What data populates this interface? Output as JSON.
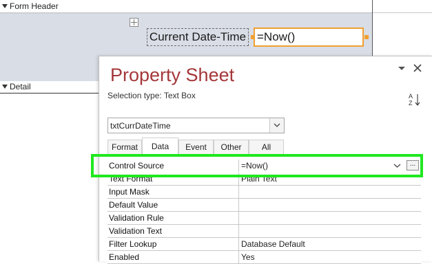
{
  "form": {
    "header_label": "Form Header",
    "detail_label": "Detail",
    "label_control_text": "Current Date-Time",
    "textbox_control_text": "=Now()"
  },
  "property_sheet": {
    "title": "Property Sheet",
    "selection_type": "Selection type:  Text Box",
    "object_combo_value": "txtCurrDateTime",
    "sort_icon_text": "A\nZ",
    "tabs": [
      {
        "label": "Format"
      },
      {
        "label": "Data"
      },
      {
        "label": "Event"
      },
      {
        "label": "Other"
      },
      {
        "label": "All"
      }
    ],
    "active_tab": "Data",
    "control_source": {
      "name": "Control Source",
      "value": "=Now()",
      "build_label": "..."
    },
    "rows": [
      {
        "name": "Text Format",
        "value": "Plain Text"
      },
      {
        "name": "Input Mask",
        "value": ""
      },
      {
        "name": "Default Value",
        "value": ""
      },
      {
        "name": "Validation Rule",
        "value": ""
      },
      {
        "name": "Validation Text",
        "value": ""
      },
      {
        "name": "Filter Lookup",
        "value": "Database Default"
      },
      {
        "name": "Enabled",
        "value": "Yes"
      }
    ]
  },
  "colors": {
    "title_red": "#a4373a",
    "highlight_green": "#1fe81f",
    "selection_orange": "#f0a030",
    "header_band": "#d9dde6"
  }
}
